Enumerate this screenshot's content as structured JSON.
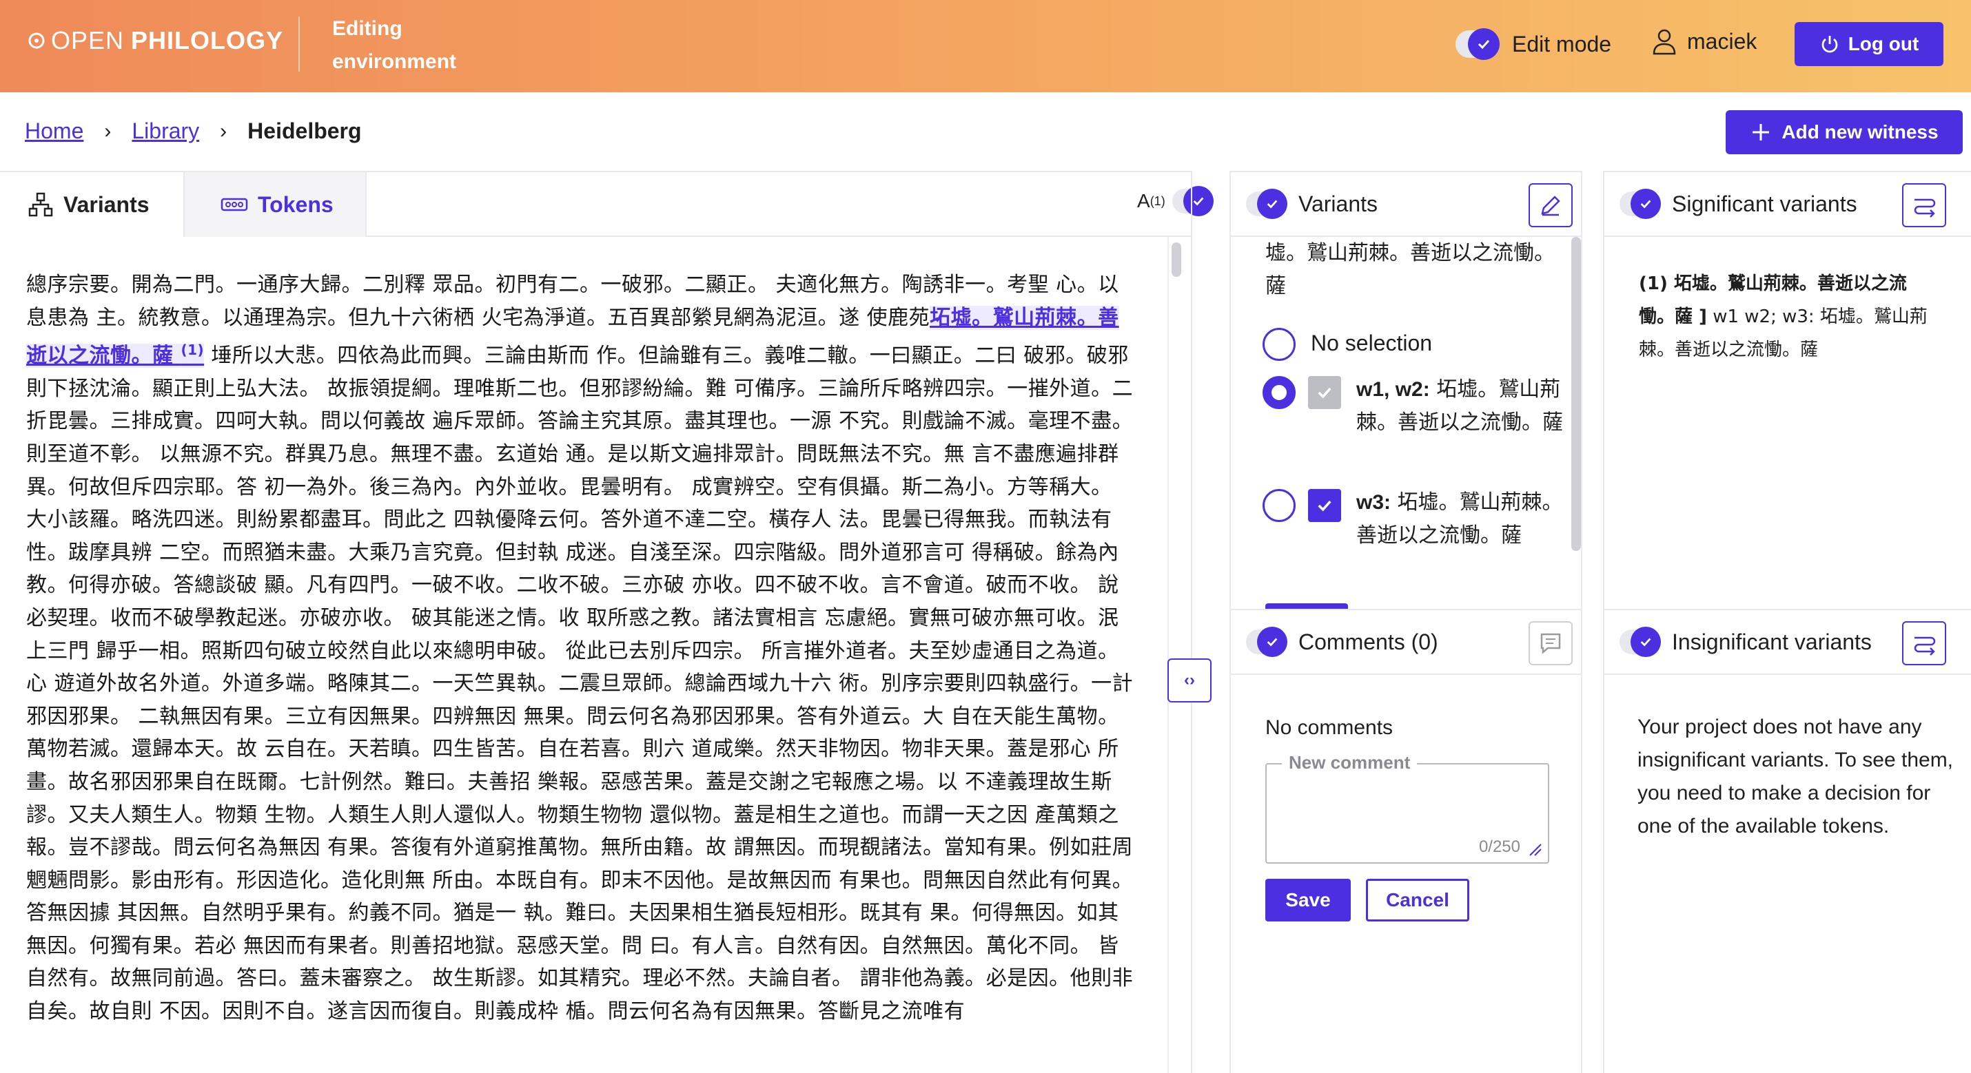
{
  "header": {
    "logo_light": "OPEN",
    "logo_bold": "PHILOLOGY",
    "environment_label": "Editing environment",
    "edit_mode_label": "Edit mode",
    "username": "maciek",
    "logout_label": "Log out"
  },
  "breadcrumb": {
    "home": "Home",
    "library": "Library",
    "current": "Heidelberg"
  },
  "add_witness_label": "Add new witness",
  "tabs": {
    "variants": "Variants",
    "tokens": "Tokens",
    "mode_label": "A",
    "mode_sup": "(1)"
  },
  "text": {
    "before": "總序宗要。開為二門。一通序大歸。二別釋 眾品。初門有二。一破邪。二顯正。 夫適化無方。陶誘非一。考聖 心。以息患為 主。統教意。以通理為宗。但九十六術栖 火宅為淨道。五百異部縈見網為泥洹。遂 使鹿苑",
    "highlight": "坧墟。鷲山荊棘。善逝以之流慟。薩",
    "highlight_sup": "(1)",
    "after": " 埵所以大悲。四依為此而興。三論由斯而 作。但論雖有三。義唯二轍。一曰顯正。二曰 破邪。破邪則下拯沈淪。顯正則上弘大法。 故振領提綱。理唯斯二也。但邪謬紛綸。難 可備序。三論所斥略辨四宗。一摧外道。二 折毘曇。三排成實。四呵大執。問以何義故 遍斥眾師。答論主究其原。盡其理也。一源 不究。則戲論不滅。毫理不盡。則至道不彰。 以無源不究。群異乃息。無理不盡。玄道始 通。是以斯文遍排眾計。問既無法不究。無 言不盡應遍排群異。何故但斥四宗耶。答 初一為外。後三為內。內外並收。毘曇明有。 成實辨空。空有俱攝。斯二為小。方等稱大。 大小該羅。略洗四迷。則紛累都盡耳。問此之 四執優降云何。答外道不達二空。橫存人 法。毘曇已得無我。而執法有性。跋摩具辨 二空。而照猶未盡。大乘乃言究竟。但封執 成迷。自淺至深。四宗階級。問外道邪言可 得稱破。餘為內教。何得亦破。答總談破 顯。凡有四門。一破不收。二收不破。三亦破 亦收。四不破不收。言不會道。破而不收。 說必契理。收而不破學教起迷。亦破亦收。 破其能迷之情。收 取所惑之教。諸法實相言 忘慮絕。實無可破亦無可收。泯上三門 歸乎一相。照斯四句破立皎然自此以來總明申破。 從此已去別斥四宗。 所言摧外道者。夫至妙虛通目之為道。心 遊道外故名外道。外道多端。略陳其二。一天竺異執。二震旦眾師。總論西域九十六 術。別序宗要則四執盛行。一計邪因邪果。 二執無因有果。三立有因無果。四辨無因 無果。問云何名為邪因邪果。答有外道云。大 自在天能生萬物。萬物若滅。還歸本天。故 云自在。天若瞋。四生皆苦。自在若喜。則六 道咸樂。然天非物因。物非天果。蓋是邪心 所畫。故名邪因邪果自在既爾。七計例然。難曰。夫善招 樂報。惡感苦果。蓋是交謝之宅報應之場。以 不達義理故生斯謬。又夫人類生人。物類 生物。人類生人則人還似人。物類生物物 還似物。蓋是相生之道也。而謂一天之因 產萬類之報。豈不謬哉。問云何名為無因 有果。答復有外道窮推萬物。無所由籍。故 謂無因。而現覩諸法。當知有果。例如莊周 魍魎問影。影由形有。形因造化。造化則無 所由。本既自有。即末不因他。是故無因而 有果也。問無因自然此有何異。答無因據 其因無。自然明乎果有。約義不同。猶是一 執。難曰。夫因果相生猶長短相形。既其有 果。何得無因。如其無因。何獨有果。若必 無因而有果者。則善招地獄。惡感天堂。問 曰。有人言。自然有因。自然無因。萬化不同。 皆自然有。故無同前過。答曰。蓋未審察之。 故生斯謬。如其精究。理必不然。夫論自者。 謂非他為義。必是因。他則非自矣。故自則 不因。因則不自。遂言因而復自。則義成枠 楯。問云何名為有因無果。答斷見之流唯有"
  },
  "variants_panel": {
    "title": "Variants",
    "top_text": "墟。鷲山荊棘。善逝以之流慟。薩",
    "no_selection": "No selection",
    "opt1_label": "w1, w2:",
    "opt1_text": " 坧墟。鷲山荊棘。善逝以之流慟。薩",
    "opt2_label": "w3:",
    "opt2_text": " 坧墟。鷲山荊棘。善逝以之流慟。薩"
  },
  "significant_panel": {
    "title": "Significant variants",
    "entry_bold": "(1) 坧墟。鷲山荊棘。善逝以之流慟。薩 ]",
    "entry_rest": " w1 w2; w3: 坧墟。鷲山荊棘。善逝以之流慟。薩"
  },
  "comments_panel": {
    "title": "Comments (0)",
    "empty": "No comments",
    "placeholder": "New comment",
    "counter": "0/250",
    "save": "Save",
    "cancel": "Cancel"
  },
  "insignificant_panel": {
    "title": "Insignificant variants",
    "message": "Your project does not have any insignificant variants. To see them, you need to make a decision for one of the available tokens."
  },
  "colors": {
    "accent": "#4b2fe0",
    "header_start": "#ef8a59",
    "header_end": "#f7c26a"
  }
}
